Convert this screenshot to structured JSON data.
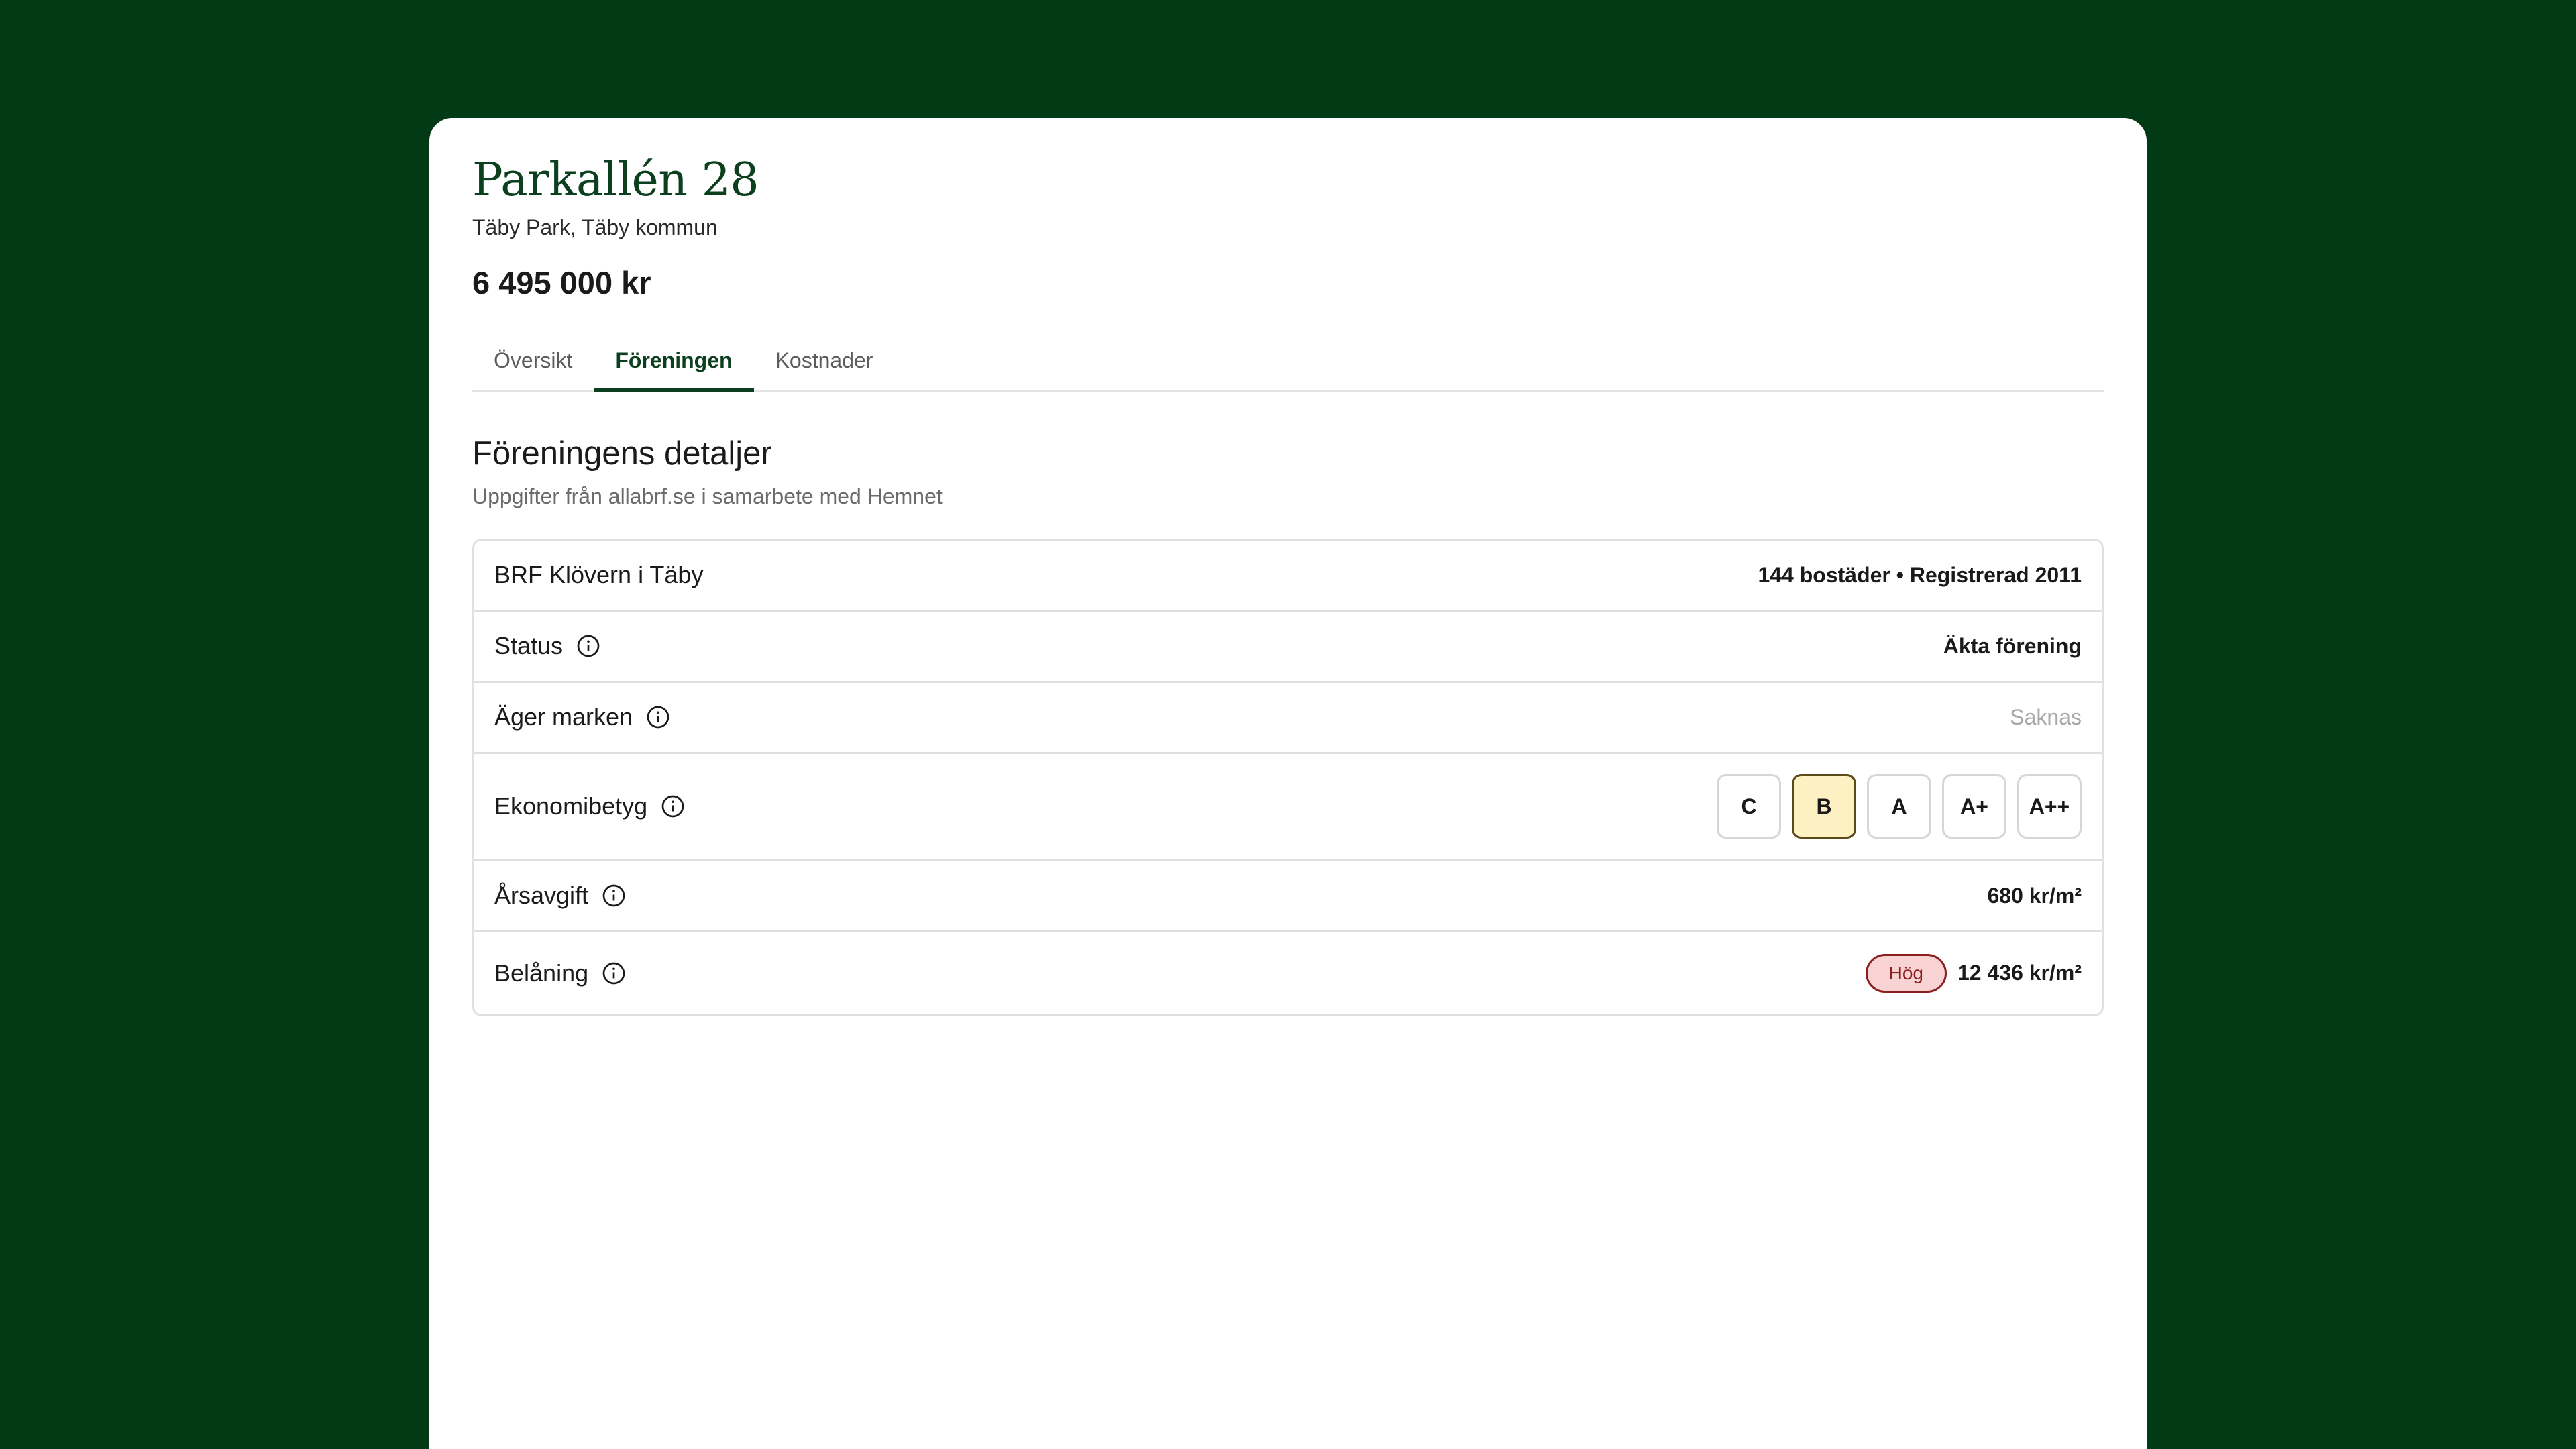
{
  "listing": {
    "title": "Parkallén 28",
    "location": "Täby Park, Täby kommun",
    "price": "6 495 000 kr"
  },
  "tabs": [
    {
      "label": "Översikt",
      "active": false
    },
    {
      "label": "Föreningen",
      "active": true
    },
    {
      "label": "Kostnader",
      "active": false
    }
  ],
  "section": {
    "title": "Föreningens detaljer",
    "subtitle": "Uppgifter från allabrf.se i samarbete med Hemnet"
  },
  "association": {
    "name": "BRF Klövern i Täby",
    "summary": "144 bostäder • Registrerad 2011"
  },
  "rows": {
    "status": {
      "label": "Status",
      "value": "Äkta förening"
    },
    "land": {
      "label": "Äger marken",
      "value": "Saknas"
    },
    "rating": {
      "label": "Ekonomibetyg",
      "grades": [
        "C",
        "B",
        "A",
        "A+",
        "A++"
      ],
      "selected": "B"
    },
    "fee": {
      "label": "Årsavgift",
      "value": "680 kr/m²"
    },
    "loan": {
      "label": "Belåning",
      "badge": "Hög",
      "value": "12 436 kr/m²"
    }
  },
  "colors": {
    "background": "#023a16",
    "brand": "#0c3f1e",
    "grade_selected_bg": "#fdf1c4",
    "badge_bg": "#f9d3d3",
    "badge_text": "#8a1f1f"
  },
  "icons": {
    "info": "info-circle-icon"
  }
}
